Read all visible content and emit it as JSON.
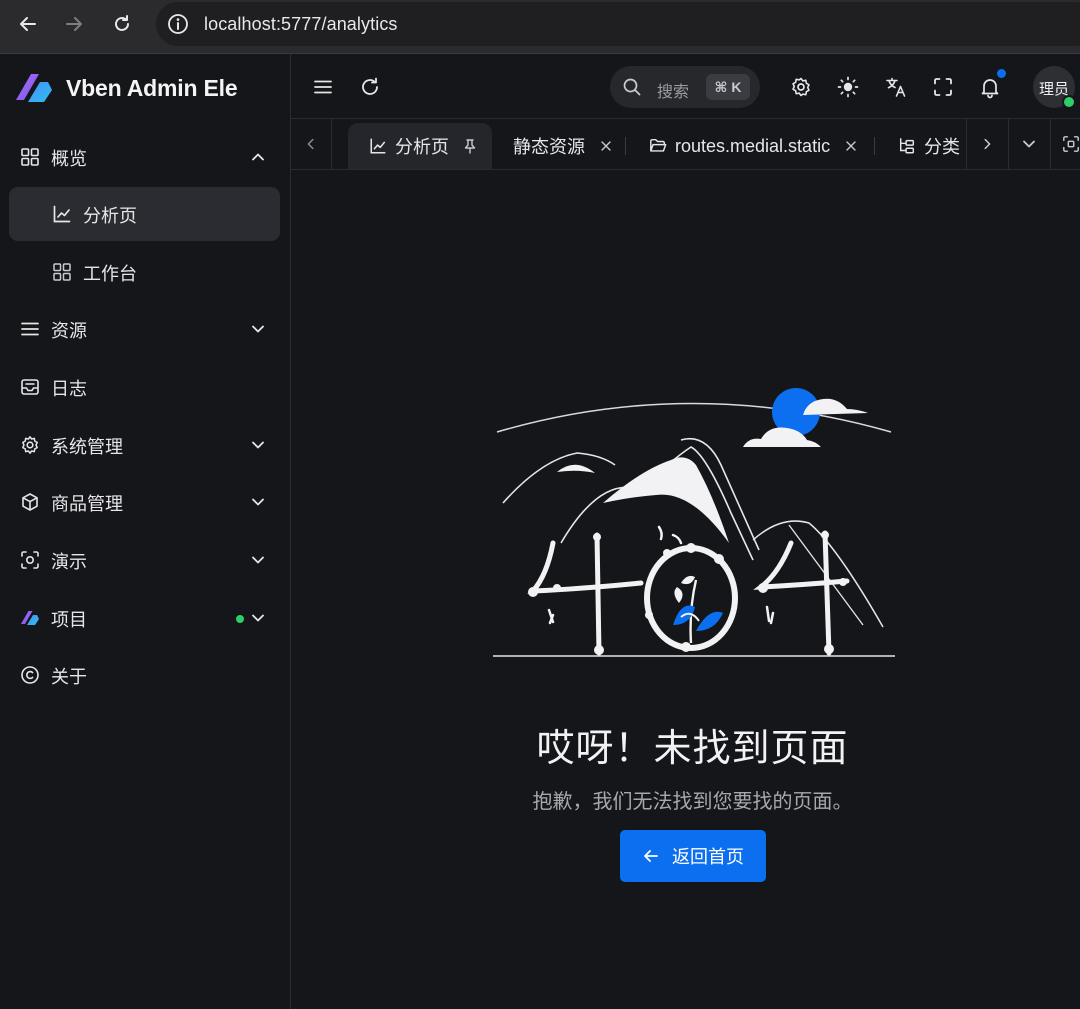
{
  "browser": {
    "url": "localhost:5777/analytics"
  },
  "app": {
    "name": "Vben Admin Ele",
    "accent": "#0b6ff0"
  },
  "sidebar": {
    "items": [
      {
        "label": "概览",
        "icon": "grid-icon"
      },
      {
        "label": "分析页",
        "icon": "chart-icon"
      },
      {
        "label": "工作台",
        "icon": "grid-icon"
      },
      {
        "label": "资源",
        "icon": "menu-icon"
      },
      {
        "label": "日志",
        "icon": "inbox-icon"
      },
      {
        "label": "系统管理",
        "icon": "gear-icon"
      },
      {
        "label": "商品管理",
        "icon": "box-icon"
      },
      {
        "label": "演示",
        "icon": "focus-icon"
      },
      {
        "label": "项目",
        "icon": "logo-icon"
      },
      {
        "label": "关于",
        "icon": "copyright-icon"
      }
    ]
  },
  "header": {
    "search_label": "搜索",
    "search_kbd": "⌘ K",
    "avatar_text": "理员"
  },
  "tabs": [
    {
      "label": "分析页",
      "icon": "chart-icon"
    },
    {
      "label": "静态资源"
    },
    {
      "label": "routes.medial.static",
      "icon": "folder-icon"
    },
    {
      "label": "分类",
      "icon": "tree-icon"
    }
  ],
  "error": {
    "title": "哎呀！未找到页面",
    "description": "抱歉，我们无法找到您要找的页面。",
    "button_label": "返回首页"
  }
}
